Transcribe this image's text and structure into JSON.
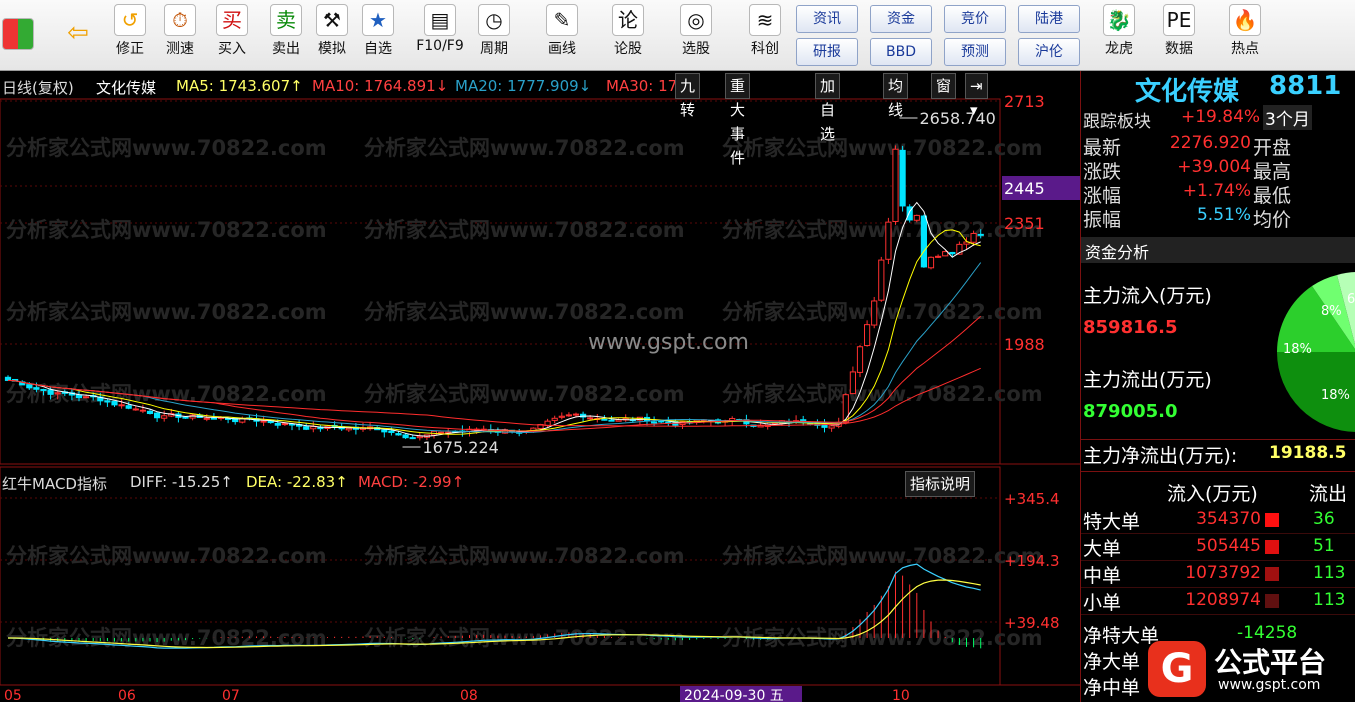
{
  "toolbar": {
    "buttons": [
      {
        "label": "",
        "icon": "grid-icon"
      },
      {
        "label": "",
        "icon": "back-arrow-icon"
      },
      {
        "label": "修正",
        "icon": "correction-icon"
      },
      {
        "label": "测速",
        "icon": "speed-test-icon"
      },
      {
        "label": "买入",
        "icon": "buy-icon"
      },
      {
        "label": "卖出",
        "icon": "sell-icon"
      },
      {
        "label": "模拟",
        "icon": "hammer-icon"
      },
      {
        "label": "自选",
        "icon": "star-icon"
      },
      {
        "label": "F10/F9",
        "icon": "f10-icon"
      },
      {
        "label": "周期",
        "icon": "period-icon"
      },
      {
        "label": "画线",
        "icon": "pencil-icon"
      },
      {
        "label": "论股",
        "icon": "discuss-icon"
      },
      {
        "label": "选股",
        "icon": "select-stock-icon"
      },
      {
        "label": "科创",
        "icon": "sci-tech-icon"
      },
      {
        "label": "龙虎",
        "icon": "dragon-tiger-icon"
      },
      {
        "label": "数据",
        "icon": "data-pe-icon"
      },
      {
        "label": "热点",
        "icon": "hot-icon"
      }
    ],
    "small_buttons_top": [
      "资讯",
      "资金",
      "竞价",
      "陆港"
    ],
    "small_buttons_bottom": [
      "研报",
      "BBD",
      "预测",
      "沪伦"
    ]
  },
  "chart_header": {
    "period": "日线(复权)",
    "name": "文化传媒",
    "ma5": "MA5: 1743.607↑",
    "ma10": "MA10: 1764.891↓",
    "ma20": "MA20: 1777.909↓",
    "ma30": "MA30: 17",
    "tabs": [
      "九转",
      "重大事件",
      "加自选",
      "均线",
      "窗"
    ]
  },
  "price_axis": [
    "2713",
    "2445",
    "2351",
    "1988"
  ],
  "annotations": {
    "high": "2658.740",
    "low": "1675.224",
    "site": "www.gspt.com"
  },
  "macd_header": {
    "title": "红牛MACD指标",
    "diff": "DIFF: -15.25↑",
    "dea": "DEA: -22.83↑",
    "macd": "MACD: -2.99↑",
    "explain": "指标说明"
  },
  "macd_axis": [
    "+345.4",
    "+194.3",
    "+39.48"
  ],
  "date_axis": [
    "05",
    "06",
    "07",
    "08",
    "2024-09-30 五",
    "10"
  ],
  "watermark": "分析家公式网www.70822.com",
  "right_panel": {
    "title": "文化传媒",
    "code": "8811",
    "track_label": "跟踪板块",
    "track_value": "+19.84%",
    "track_period": "3个月",
    "rows": [
      {
        "label": "最新",
        "value": "2276.920",
        "side": "开盘"
      },
      {
        "label": "涨跌",
        "value": "+39.004",
        "side": "最高"
      },
      {
        "label": "涨幅",
        "value": "+1.74%",
        "side": "最低"
      },
      {
        "label": "振幅",
        "value": "5.51%",
        "side": "均价"
      }
    ],
    "fund_title": "资金分析",
    "inflow_label": "主力流入(万元)",
    "inflow_value": "859816.5",
    "outflow_label": "主力流出(万元)",
    "outflow_value": "879005.0",
    "net_label": "主力净流出(万元):",
    "net_value": "19188.5",
    "pie_labels": [
      "8%",
      "6%",
      "18%",
      "18%"
    ],
    "table_head": "流入(万元)",
    "table_head2": "流出",
    "table": [
      {
        "label": "特大单",
        "value": "354370",
        "right": "36"
      },
      {
        "label": "大单",
        "value": "505445",
        "right": "51"
      },
      {
        "label": "中单",
        "value": "1073792",
        "right": "113"
      },
      {
        "label": "小单",
        "value": "1208974",
        "right": "113"
      }
    ],
    "net_rows": [
      {
        "label": "净特大单",
        "value": "-14258"
      },
      {
        "label": "净大单",
        "value": ""
      },
      {
        "label": "净中单",
        "value": ""
      }
    ]
  },
  "logo": {
    "name": "公式平台",
    "url": "www.gspt.com"
  },
  "colors": {
    "up": "#ff3030",
    "down": "#00e5ff",
    "ma5": "#ffffff",
    "ma10": "#ffff00",
    "ma20": "#2aa1c9",
    "ma30": "#ff2d2d"
  }
}
